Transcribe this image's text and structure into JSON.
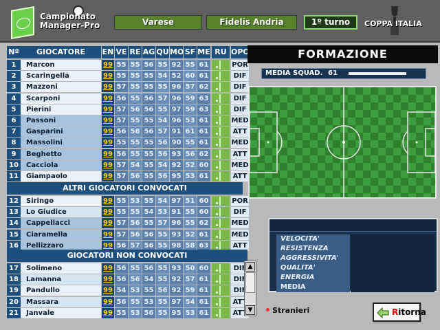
{
  "header": {
    "app_title_line1": "Campionato",
    "app_title_line2": "Manager-Pro",
    "home_team": "Varese",
    "away_team": "Fidelis Andria",
    "round": "1º turno",
    "cup": "COPPA ITALIA"
  },
  "table": {
    "headers": [
      "Nº",
      "GIOCATORE",
      "EN",
      "VE",
      "RE",
      "AG",
      "QU",
      "MO",
      "SF",
      "ME",
      "RU",
      "OPOS"
    ],
    "starters": [
      {
        "n": "1",
        "name": "Marcon",
        "en": "99",
        "stats": [
          "55",
          "55",
          "56",
          "55",
          "92",
          "55",
          "61"
        ],
        "role": "POR"
      },
      {
        "n": "2",
        "name": "Scaringella",
        "en": "99",
        "stats": [
          "55",
          "55",
          "55",
          "54",
          "52",
          "60",
          "61"
        ],
        "role": "DIF"
      },
      {
        "n": "3",
        "name": "Mazzoni",
        "en": "99",
        "stats": [
          "57",
          "55",
          "55",
          "55",
          "96",
          "57",
          "62"
        ],
        "role": "DIF"
      },
      {
        "n": "4",
        "name": "Scarponi",
        "en": "99",
        "stats": [
          "56",
          "55",
          "56",
          "57",
          "96",
          "59",
          "63"
        ],
        "role": "DIF"
      },
      {
        "n": "5",
        "name": "Pierini",
        "en": "99",
        "stats": [
          "57",
          "56",
          "56",
          "55",
          "97",
          "59",
          "63"
        ],
        "role": "DIF"
      },
      {
        "n": "6",
        "name": "Passoni",
        "en": "99",
        "stats": [
          "57",
          "55",
          "55",
          "54",
          "96",
          "53",
          "61"
        ],
        "role": "MED"
      },
      {
        "n": "7",
        "name": "Gasparini",
        "en": "99",
        "stats": [
          "56",
          "58",
          "56",
          "57",
          "91",
          "61",
          "61"
        ],
        "role": "ATT"
      },
      {
        "n": "8",
        "name": "Massolini",
        "en": "99",
        "stats": [
          "55",
          "55",
          "55",
          "56",
          "90",
          "55",
          "61"
        ],
        "role": "MED"
      },
      {
        "n": "9",
        "name": "Beghetto",
        "en": "99",
        "stats": [
          "56",
          "55",
          "55",
          "56",
          "93",
          "56",
          "62"
        ],
        "role": "ATT"
      },
      {
        "n": "10",
        "name": "Cacciola",
        "en": "99",
        "stats": [
          "57",
          "54",
          "55",
          "54",
          "92",
          "52",
          "60"
        ],
        "role": "MED"
      },
      {
        "n": "11",
        "name": "Giampaolo",
        "en": "99",
        "stats": [
          "57",
          "56",
          "55",
          "56",
          "95",
          "53",
          "61"
        ],
        "role": "ATT"
      }
    ],
    "section_convocati": "ALTRI GIOCATORI CONVOCATI",
    "subs": [
      {
        "n": "12",
        "name": "Siringo",
        "en": "99",
        "stats": [
          "55",
          "53",
          "55",
          "54",
          "97",
          "51",
          "60"
        ],
        "role": "POR"
      },
      {
        "n": "13",
        "name": "Lo Giudice",
        "en": "99",
        "stats": [
          "55",
          "55",
          "54",
          "53",
          "91",
          "55",
          "60"
        ],
        "role": "DIF"
      },
      {
        "n": "14",
        "name": "Cappellacci",
        "en": "99",
        "stats": [
          "57",
          "56",
          "55",
          "57",
          "96",
          "55",
          "62"
        ],
        "role": "MED"
      },
      {
        "n": "15",
        "name": "Ciaramella",
        "en": "99",
        "stats": [
          "57",
          "56",
          "56",
          "55",
          "93",
          "52",
          "61"
        ],
        "role": "MED"
      },
      {
        "n": "16",
        "name": "Pellizzaro",
        "en": "99",
        "stats": [
          "56",
          "57",
          "56",
          "55",
          "98",
          "58",
          "63"
        ],
        "role": "ATT"
      }
    ],
    "section_nonconvocati": "GIOCATORI NON CONVOCATI",
    "others": [
      {
        "n": "17",
        "name": "Solimeno",
        "en": "99",
        "stats": [
          "56",
          "55",
          "56",
          "55",
          "93",
          "50",
          "60"
        ],
        "role": "DIF"
      },
      {
        "n": "18",
        "name": "Lamanna",
        "en": "99",
        "stats": [
          "56",
          "56",
          "54",
          "55",
          "92",
          "57",
          "61"
        ],
        "role": "DIF"
      },
      {
        "n": "19",
        "name": "Pandullo",
        "en": "99",
        "stats": [
          "54",
          "53",
          "55",
          "56",
          "92",
          "59",
          "61"
        ],
        "role": "DIF"
      },
      {
        "n": "20",
        "name": "Massara",
        "en": "99",
        "stats": [
          "56",
          "55",
          "53",
          "55",
          "97",
          "54",
          "61"
        ],
        "role": "ATT"
      },
      {
        "n": "21",
        "name": "Janvale",
        "en": "99",
        "stats": [
          "55",
          "53",
          "56",
          "55",
          "95",
          "53",
          "61"
        ],
        "role": "ATT"
      }
    ]
  },
  "formation": {
    "title": "FORMAZIONE",
    "avg_label": "MEDIA SQUAD.",
    "avg_value": "61"
  },
  "attributes": [
    "VELOCITA'",
    "RESISTENZA",
    "AGGRESSIVITA'",
    "QUALITA'",
    "ENERGIA",
    "MEDIA"
  ],
  "footer": {
    "stranieri": "Stranieri",
    "ritorna_first": "R",
    "ritorna_rest": "itorna"
  },
  "colors": {
    "accent_green": "#7bb84a",
    "table_blue": "#1d4f7c",
    "en_yellow": "#ffcf00",
    "foreigner_dot": "#ff2a2a"
  },
  "icons": [
    "pitch-logo-icon",
    "ball-icon",
    "trophy-icon",
    "arrow-left-icon",
    "scroll-up-icon",
    "scroll-down-icon"
  ]
}
